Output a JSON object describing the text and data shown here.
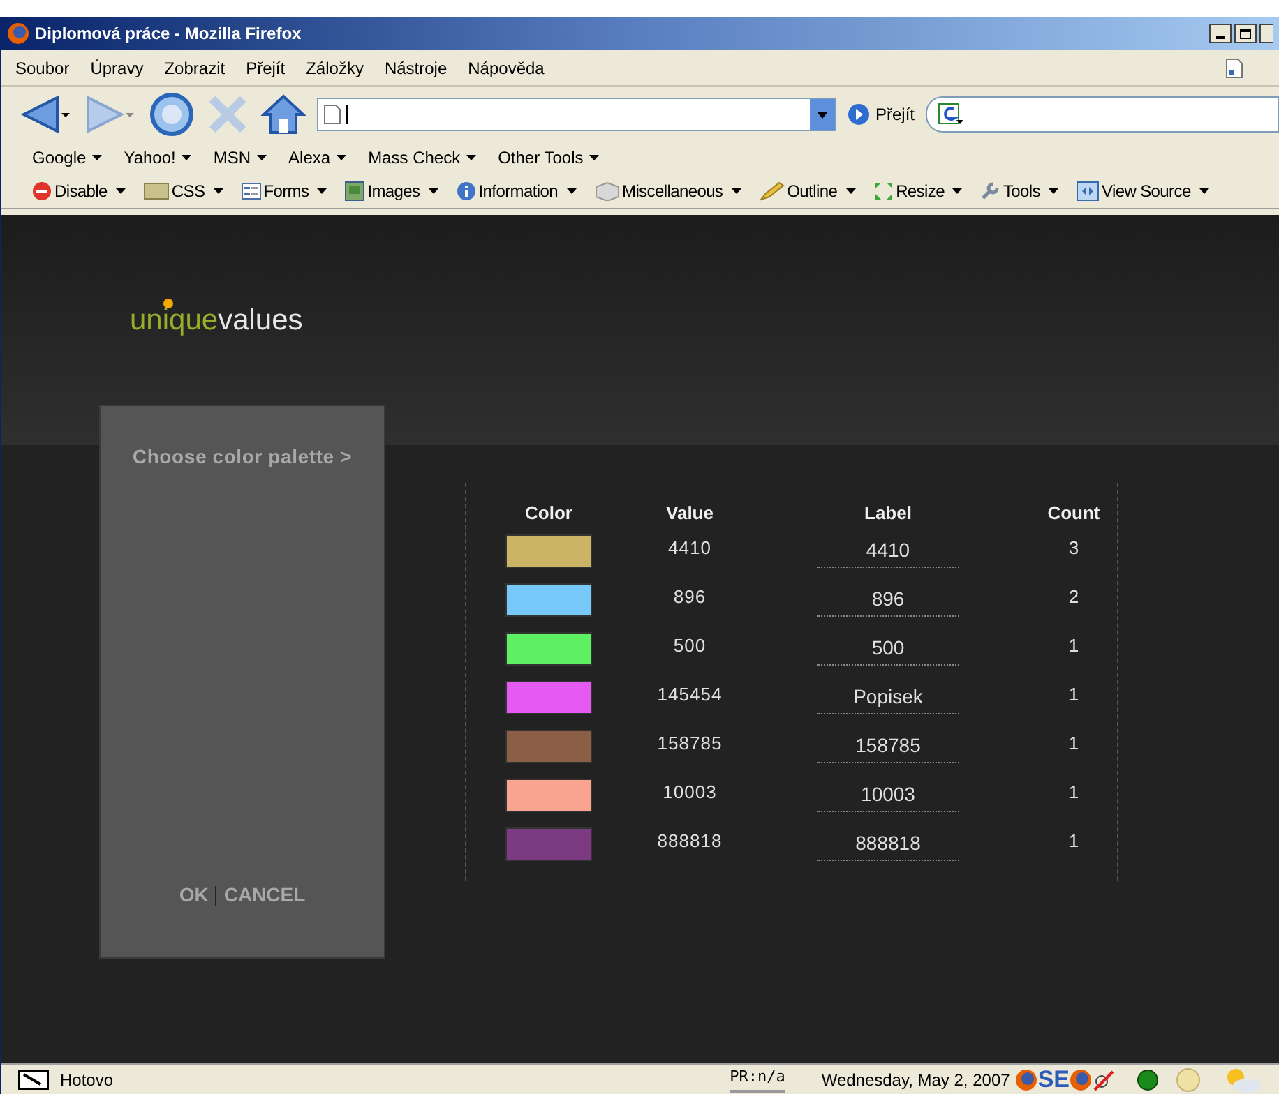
{
  "window": {
    "title": "Diplomová práce - Mozilla Firefox"
  },
  "menu": [
    "Soubor",
    "Úpravy",
    "Zobrazit",
    "Přejít",
    "Záložky",
    "Nástroje",
    "Nápověda"
  ],
  "navigation": {
    "go_label": "Přejít"
  },
  "search_toolbar": [
    "Google",
    "Yahoo!",
    "MSN",
    "Alexa",
    "Mass Check",
    "Other Tools"
  ],
  "developer_toolbar": [
    "Disable",
    "CSS",
    "Forms",
    "Images",
    "Information",
    "Miscellaneous",
    "Outline",
    "Resize",
    "Tools",
    "View Source"
  ],
  "page": {
    "logo": {
      "first": "unique",
      "second": "values"
    },
    "palette_panel": {
      "title": "Choose color palette >",
      "ok": "OK",
      "cancel": "CANCEL"
    },
    "table": {
      "columns": [
        "Color",
        "Value",
        "Label",
        "Count"
      ],
      "rows": [
        {
          "color": "#cbb465",
          "value": "4410",
          "label": "4410",
          "count": "3"
        },
        {
          "color": "#76c8f8",
          "value": "896",
          "label": "896",
          "count": "2"
        },
        {
          "color": "#5cf062",
          "value": "500",
          "label": "500",
          "count": "1"
        },
        {
          "color": "#e65af4",
          "value": "145454",
          "label": "Popisek",
          "count": "1"
        },
        {
          "color": "#8b5f46",
          "value": "158785",
          "label": "158785",
          "count": "1"
        },
        {
          "color": "#f9a48e",
          "value": "10003",
          "label": "10003",
          "count": "1"
        },
        {
          "color": "#7b3a82",
          "value": "888818",
          "label": "888818",
          "count": "1"
        }
      ]
    }
  },
  "status_bar": {
    "text": "Hotovo",
    "pagerank": "PR:n/a",
    "date": "Wednesday, May 2, 2007",
    "se": "SE"
  }
}
